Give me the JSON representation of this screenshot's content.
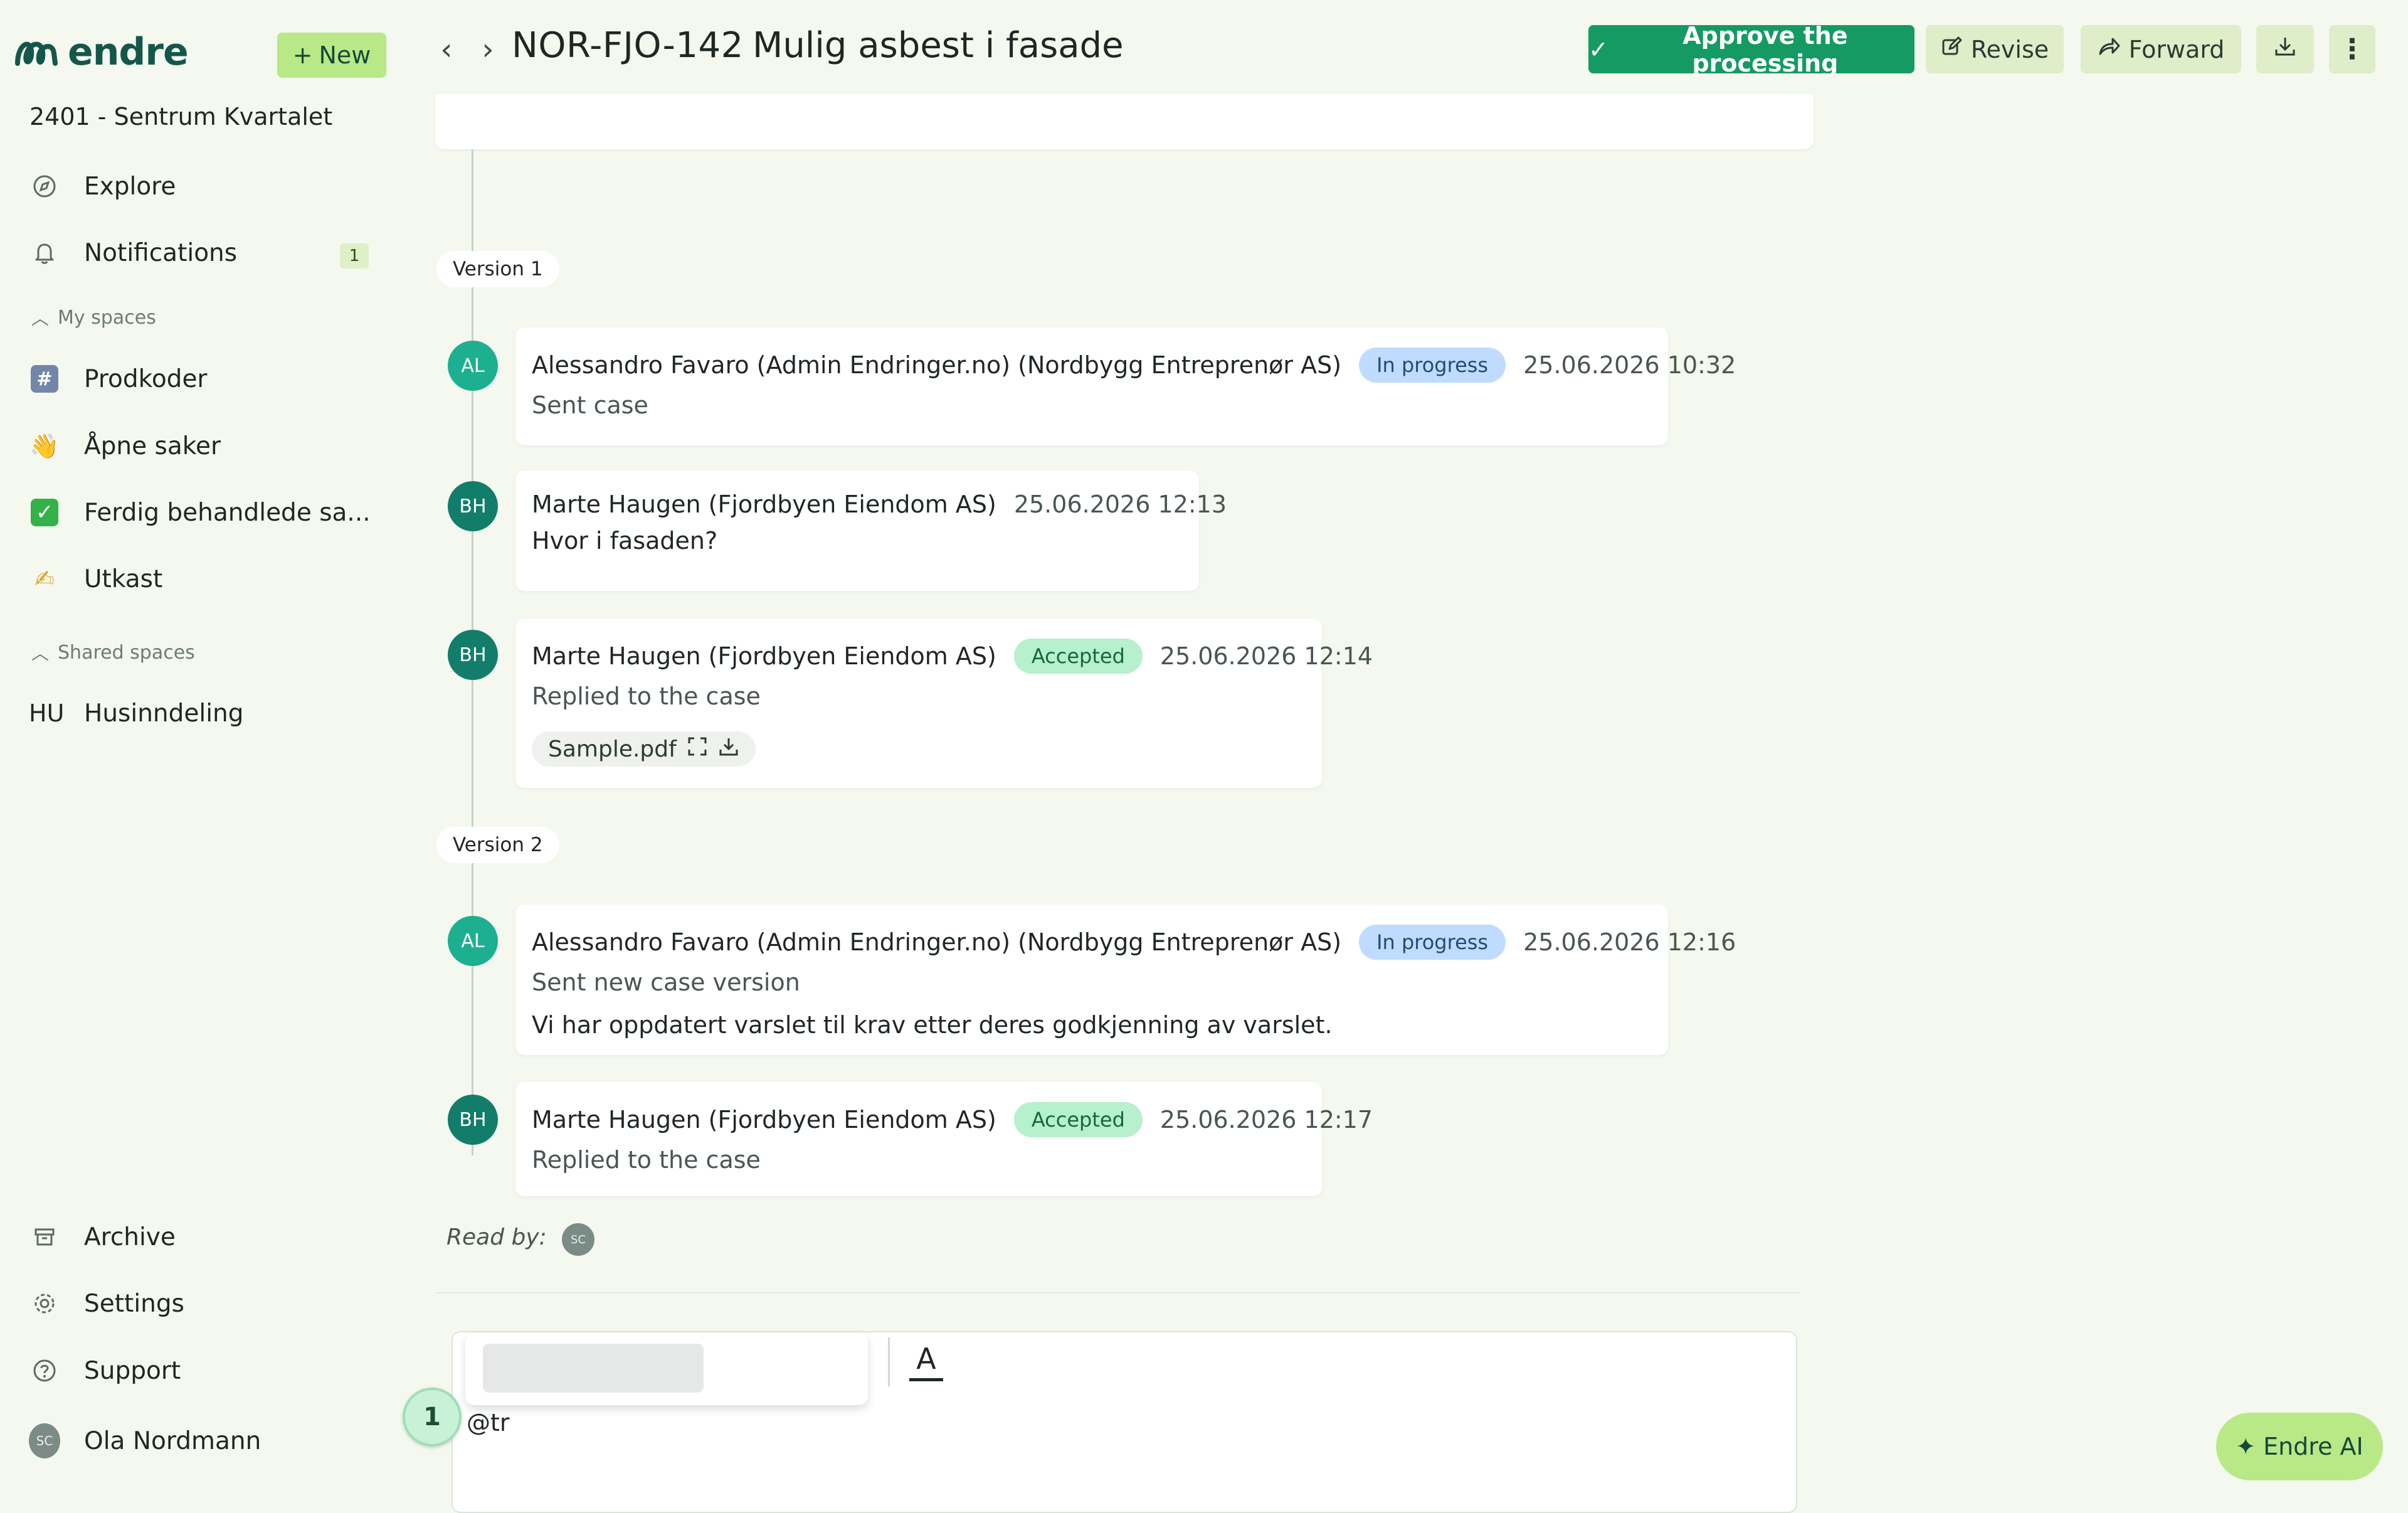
{
  "brand": {
    "name": "endre",
    "accent": "#159a63",
    "brand_color": "#14574a"
  },
  "sidebar": {
    "new_label": "New",
    "project": "2401 - Sentrum Kvartalet",
    "explore": "Explore",
    "notifications": {
      "label": "Notifications",
      "count": "1"
    },
    "my_spaces_label": "My spaces",
    "my_spaces": [
      {
        "icon": "hash-icon",
        "glyph": "#",
        "label": "Prodkoder"
      },
      {
        "icon": "waving-hand-emoji-icon",
        "glyph": "👋",
        "label": "Åpne saker"
      },
      {
        "icon": "check-box-emoji-icon",
        "glyph": "✓",
        "label": "Ferdig behandlede sa..."
      },
      {
        "icon": "writing-hand-emoji-icon",
        "glyph": "✍",
        "label": "Utkast"
      }
    ],
    "shared_spaces_label": "Shared spaces",
    "shared_spaces": [
      {
        "abbr": "HU",
        "label": "Husinndeling"
      }
    ],
    "archive": "Archive",
    "settings": "Settings",
    "support": "Support",
    "user": {
      "initials": "SC",
      "name": "Ola Nordmann"
    }
  },
  "header": {
    "case_id": "NOR-FJO-142",
    "case_title": "Mulig asbest i fasade",
    "approve_label": "Approve the processing",
    "revise_label": "Revise",
    "forward_label": "Forward"
  },
  "timeline": {
    "version1_label": "Version 1",
    "version2_label": "Version 2",
    "events": [
      {
        "initials": "AL",
        "author": "Alessandro Favaro (Admin Endringer.no) (Nordbygg Entreprenør AS)",
        "status": "In progress",
        "time": "25.06.2026 10:32",
        "subtitle": "Sent case"
      },
      {
        "initials": "BH",
        "author": "Marte Haugen (Fjordbyen Eiendom AS)",
        "time": "25.06.2026 12:13",
        "subtitle": "Hvor i fasaden?"
      },
      {
        "initials": "BH",
        "author": "Marte Haugen (Fjordbyen Eiendom AS)",
        "status": "Accepted",
        "time": "25.06.2026 12:14",
        "subtitle": "Replied to the case",
        "file": "Sample.pdf"
      },
      {
        "initials": "AL",
        "author": "Alessandro Favaro (Admin Endringer.no) (Nordbygg Entreprenør AS)",
        "status": "In progress",
        "time": "25.06.2026 12:16",
        "subtitle": "Sent new case version",
        "message": "Vi har oppdatert varslet til krav etter deres godkjenning av varslet."
      },
      {
        "initials": "BH",
        "author": "Marte Haugen (Fjordbyen Eiendom AS)",
        "status": "Accepted",
        "time": "25.06.2026 12:17",
        "subtitle": "Replied to the case"
      }
    ],
    "read_by_label": "Read by:",
    "read_by_initials": "SC"
  },
  "composer": {
    "text": "@tr",
    "step_number": "1"
  },
  "ai_button_label": "Endre AI"
}
